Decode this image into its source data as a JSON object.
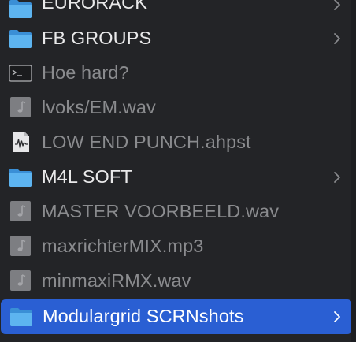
{
  "colors": {
    "background": "#232427",
    "selection": "#2a5fd3",
    "folder_blue": "#4ea7e8",
    "text_folder": "#e9e9ea",
    "text_file": "#8a8b8e"
  },
  "items": [
    {
      "label": "EURORACK",
      "kind": "folder",
      "icon": "folder-icon",
      "has_chevron": true
    },
    {
      "label": "FB GROUPS",
      "kind": "folder",
      "icon": "folder-icon",
      "has_chevron": true
    },
    {
      "label": "Hoe hard?",
      "kind": "file",
      "icon": "terminal-icon",
      "has_chevron": false
    },
    {
      "label": "lvoks/EM.wav",
      "kind": "file",
      "icon": "audio-file-icon",
      "has_chevron": false
    },
    {
      "label": "LOW END PUNCH.ahpst",
      "kind": "file",
      "icon": "waveform-file-icon",
      "has_chevron": false
    },
    {
      "label": "M4L SOFT",
      "kind": "folder",
      "icon": "folder-icon",
      "has_chevron": true
    },
    {
      "label": "MASTER VOORBEELD.wav",
      "kind": "file",
      "icon": "audio-file-icon",
      "has_chevron": false
    },
    {
      "label": "maxrichterMIX.mp3",
      "kind": "file",
      "icon": "audio-file-icon",
      "has_chevron": false
    },
    {
      "label": "minmaxiRMX.wav",
      "kind": "file",
      "icon": "audio-file-icon",
      "has_chevron": false
    },
    {
      "label": "Modulargrid SCRNshots",
      "kind": "folder",
      "icon": "folder-icon",
      "has_chevron": true,
      "selected": true
    }
  ]
}
